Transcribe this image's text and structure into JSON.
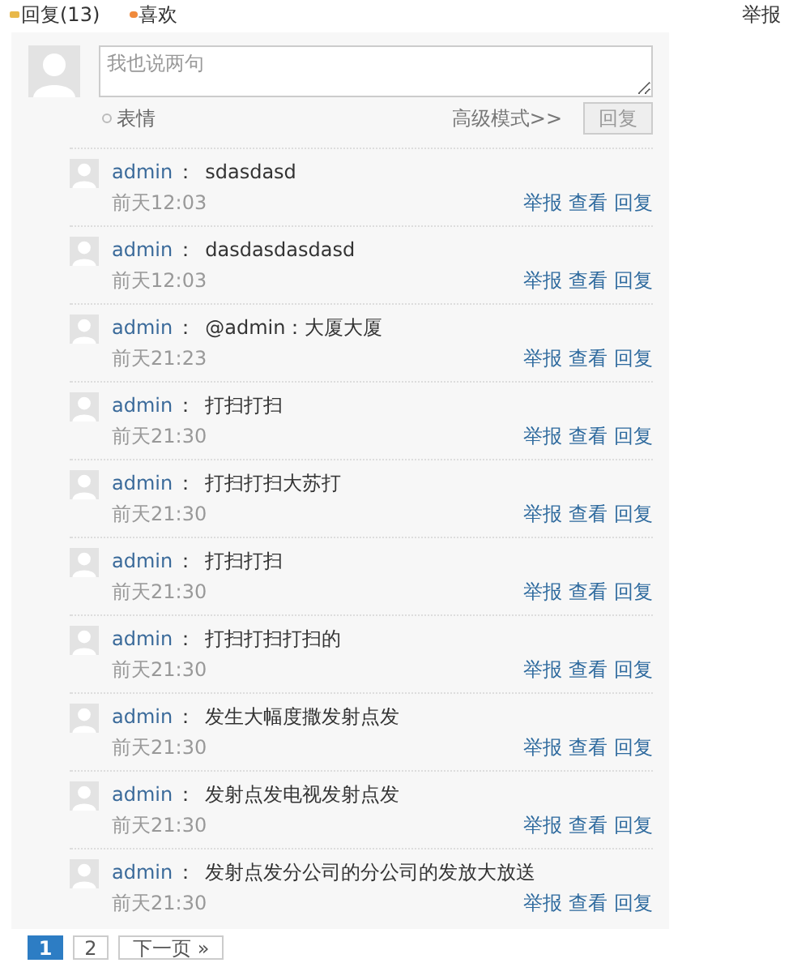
{
  "top_bar": {
    "reply_tab": "回复(13)",
    "like_tab": "喜欢",
    "report_link": "举报"
  },
  "composer": {
    "placeholder": "我也说两句",
    "emoji_label": "表情",
    "advanced_link": "高级模式>>",
    "submit_button": "回复",
    "submit_disabled": true
  },
  "comments": [
    {
      "user": "admin",
      "separator": "：",
      "text": "sdasdasd",
      "time": "前天12:03",
      "actions": [
        "举报",
        "查看",
        "回复"
      ]
    },
    {
      "user": "admin",
      "separator": "：",
      "text": "dasdasdasdasd",
      "time": "前天12:03",
      "actions": [
        "举报",
        "查看",
        "回复"
      ]
    },
    {
      "user": "admin",
      "separator": "：",
      "text": "@admin：大厦大厦",
      "time": "前天21:23",
      "actions": [
        "举报",
        "查看",
        "回复"
      ]
    },
    {
      "user": "admin",
      "separator": "：",
      "text": "打扫打扫",
      "time": "前天21:30",
      "actions": [
        "举报",
        "查看",
        "回复"
      ]
    },
    {
      "user": "admin",
      "separator": "：",
      "text": "打扫打扫大苏打",
      "time": "前天21:30",
      "actions": [
        "举报",
        "查看",
        "回复"
      ]
    },
    {
      "user": "admin",
      "separator": "：",
      "text": "打扫打扫",
      "time": "前天21:30",
      "actions": [
        "举报",
        "查看",
        "回复"
      ]
    },
    {
      "user": "admin",
      "separator": "：",
      "text": "打扫打扫打扫的",
      "time": "前天21:30",
      "actions": [
        "举报",
        "查看",
        "回复"
      ]
    },
    {
      "user": "admin",
      "separator": "：",
      "text": "发生大幅度撒发射点发",
      "time": "前天21:30",
      "actions": [
        "举报",
        "查看",
        "回复"
      ]
    },
    {
      "user": "admin",
      "separator": "：",
      "text": "发射点发电视发射点发",
      "time": "前天21:30",
      "actions": [
        "举报",
        "查看",
        "回复"
      ]
    },
    {
      "user": "admin",
      "separator": "：",
      "text": "发射点发分公司的分公司的发放大放送",
      "time": "前天21:30",
      "actions": [
        "举报",
        "查看",
        "回复"
      ]
    }
  ],
  "pagination": {
    "pages": [
      {
        "label": "1",
        "selected": true
      },
      {
        "label": "2",
        "selected": false
      }
    ],
    "next": "下一页 »"
  }
}
